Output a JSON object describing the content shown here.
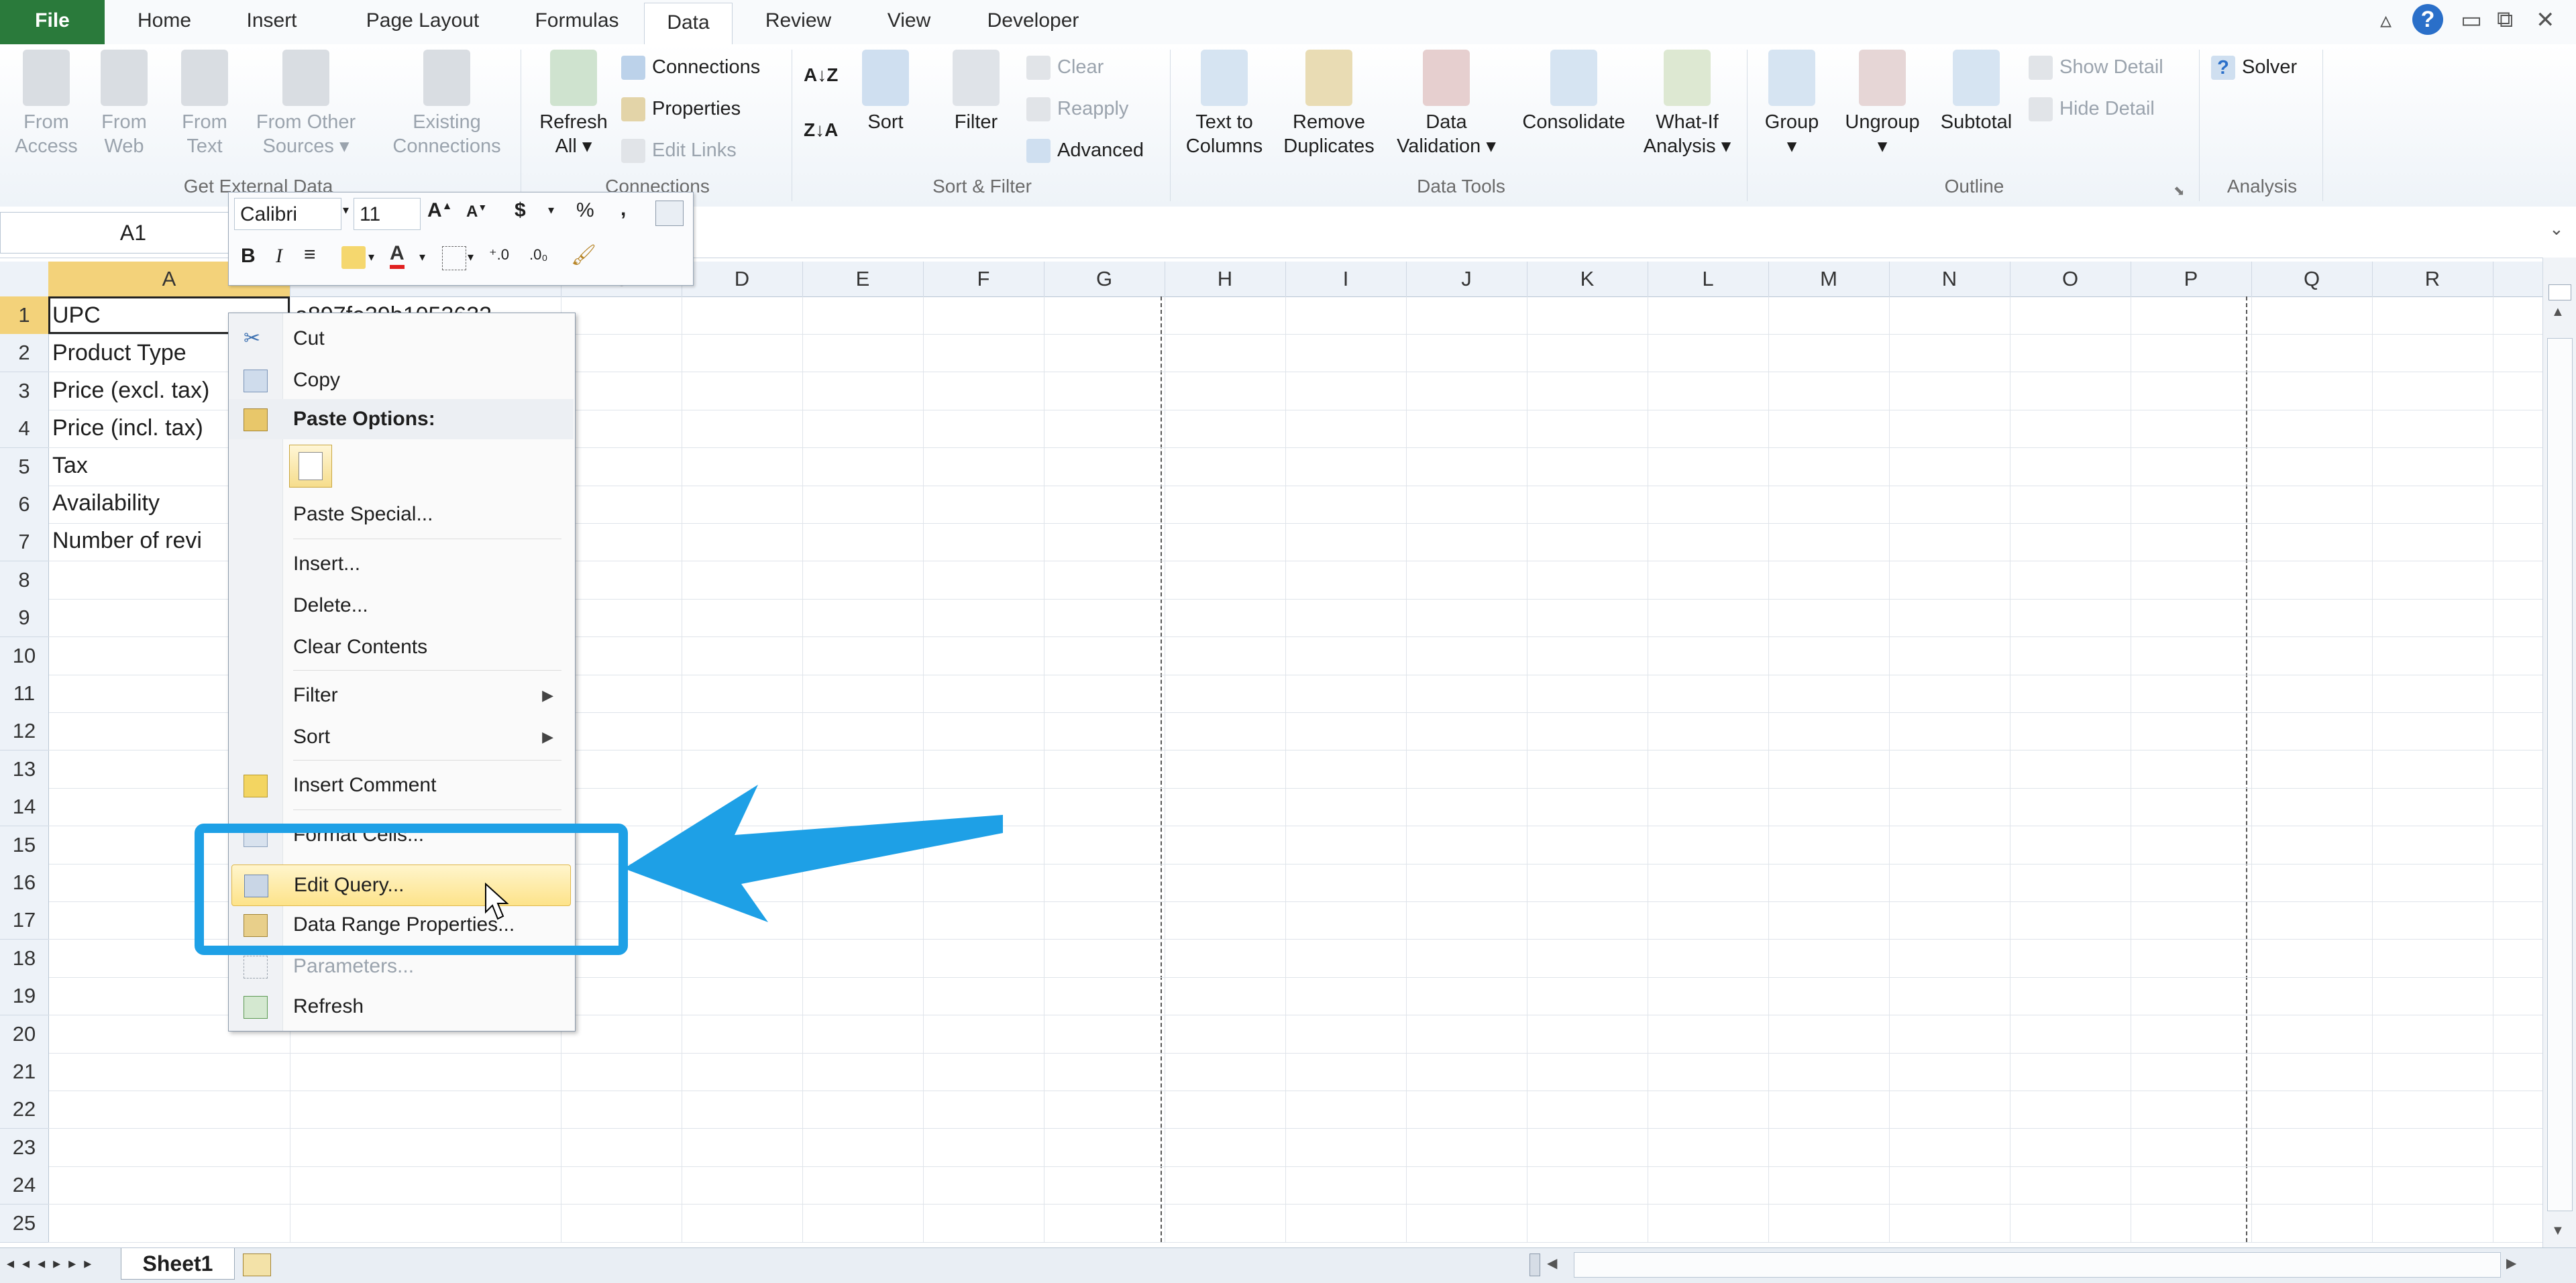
{
  "tabs": [
    "File",
    "Home",
    "Insert",
    "Page Layout",
    "Formulas",
    "Data",
    "Review",
    "View",
    "Developer"
  ],
  "active_tab": "Data",
  "ribbon": {
    "get_external": {
      "label": "Get External Data",
      "buttons": [
        {
          "line1": "From",
          "line2": "Access"
        },
        {
          "line1": "From",
          "line2": "Web"
        },
        {
          "line1": "From",
          "line2": "Text"
        },
        {
          "line1": "From Other",
          "line2": "Sources ▾"
        }
      ],
      "existing": {
        "line1": "Existing",
        "line2": "Connections"
      }
    },
    "connections": {
      "label": "Connections",
      "refresh": {
        "line1": "Refresh",
        "line2": "All ▾"
      },
      "items": [
        "Connections",
        "Properties",
        "Edit Links"
      ]
    },
    "sort_filter": {
      "label": "Sort & Filter",
      "sort": "Sort",
      "filter": "Filter",
      "items": [
        "Clear",
        "Reapply",
        "Advanced"
      ]
    },
    "data_tools": {
      "label": "Data Tools",
      "buttons": [
        {
          "line1": "Text to",
          "line2": "Columns"
        },
        {
          "line1": "Remove",
          "line2": "Duplicates"
        },
        {
          "line1": "Data",
          "line2": "Validation ▾"
        },
        {
          "line1": "Consolidate",
          "line2": ""
        },
        {
          "line1": "What-If",
          "line2": "Analysis ▾"
        }
      ]
    },
    "outline": {
      "label": "Outline",
      "buttons": [
        "Group",
        "Ungroup",
        "Subtotal"
      ],
      "items": [
        "Show Detail",
        "Hide Detail"
      ]
    },
    "analysis": {
      "label": "Analysis",
      "solver": "Solver"
    }
  },
  "namebox": "A1",
  "mini_toolbar": {
    "font": "Calibri",
    "size": "11",
    "currency": "$",
    "percent": "%",
    "comma": ","
  },
  "columns": [
    "A",
    "B",
    "C",
    "D",
    "E",
    "F",
    "G",
    "H",
    "I",
    "J",
    "K",
    "L",
    "M",
    "N",
    "O",
    "P",
    "Q",
    "R"
  ],
  "rows": [
    "1",
    "2",
    "3",
    "4",
    "5",
    "6",
    "7",
    "8",
    "9",
    "10",
    "11",
    "12",
    "13",
    "14",
    "15",
    "16",
    "17",
    "18",
    "19",
    "20",
    "21",
    "22",
    "23",
    "24",
    "25"
  ],
  "cells": {
    "A1": "UPC",
    "A2": "Product Type",
    "A3": "Price (excl. tax)",
    "A4": "Price (incl. tax)",
    "A5": "Tax",
    "A6": "Availability",
    "A7": "Number of revi",
    "B1": "a897fe39b1053632"
  },
  "context_menu": {
    "cut": "Cut",
    "copy": "Copy",
    "paste_options": "Paste Options:",
    "paste_special": "Paste Special...",
    "insert": "Insert...",
    "delete": "Delete...",
    "clear_contents": "Clear Contents",
    "filter": "Filter",
    "sort": "Sort",
    "insert_comment": "Insert Comment",
    "format_cells": "Format Cells...",
    "edit_query": "Edit Query...",
    "data_range_properties": "Data Range Properties...",
    "parameters": "Parameters...",
    "refresh": "Refresh"
  },
  "sheet_tab": "Sheet1",
  "colors": {
    "accent": "#2a7a3b",
    "highlight": "#1ea0e6",
    "selection": "#f3d27a"
  }
}
